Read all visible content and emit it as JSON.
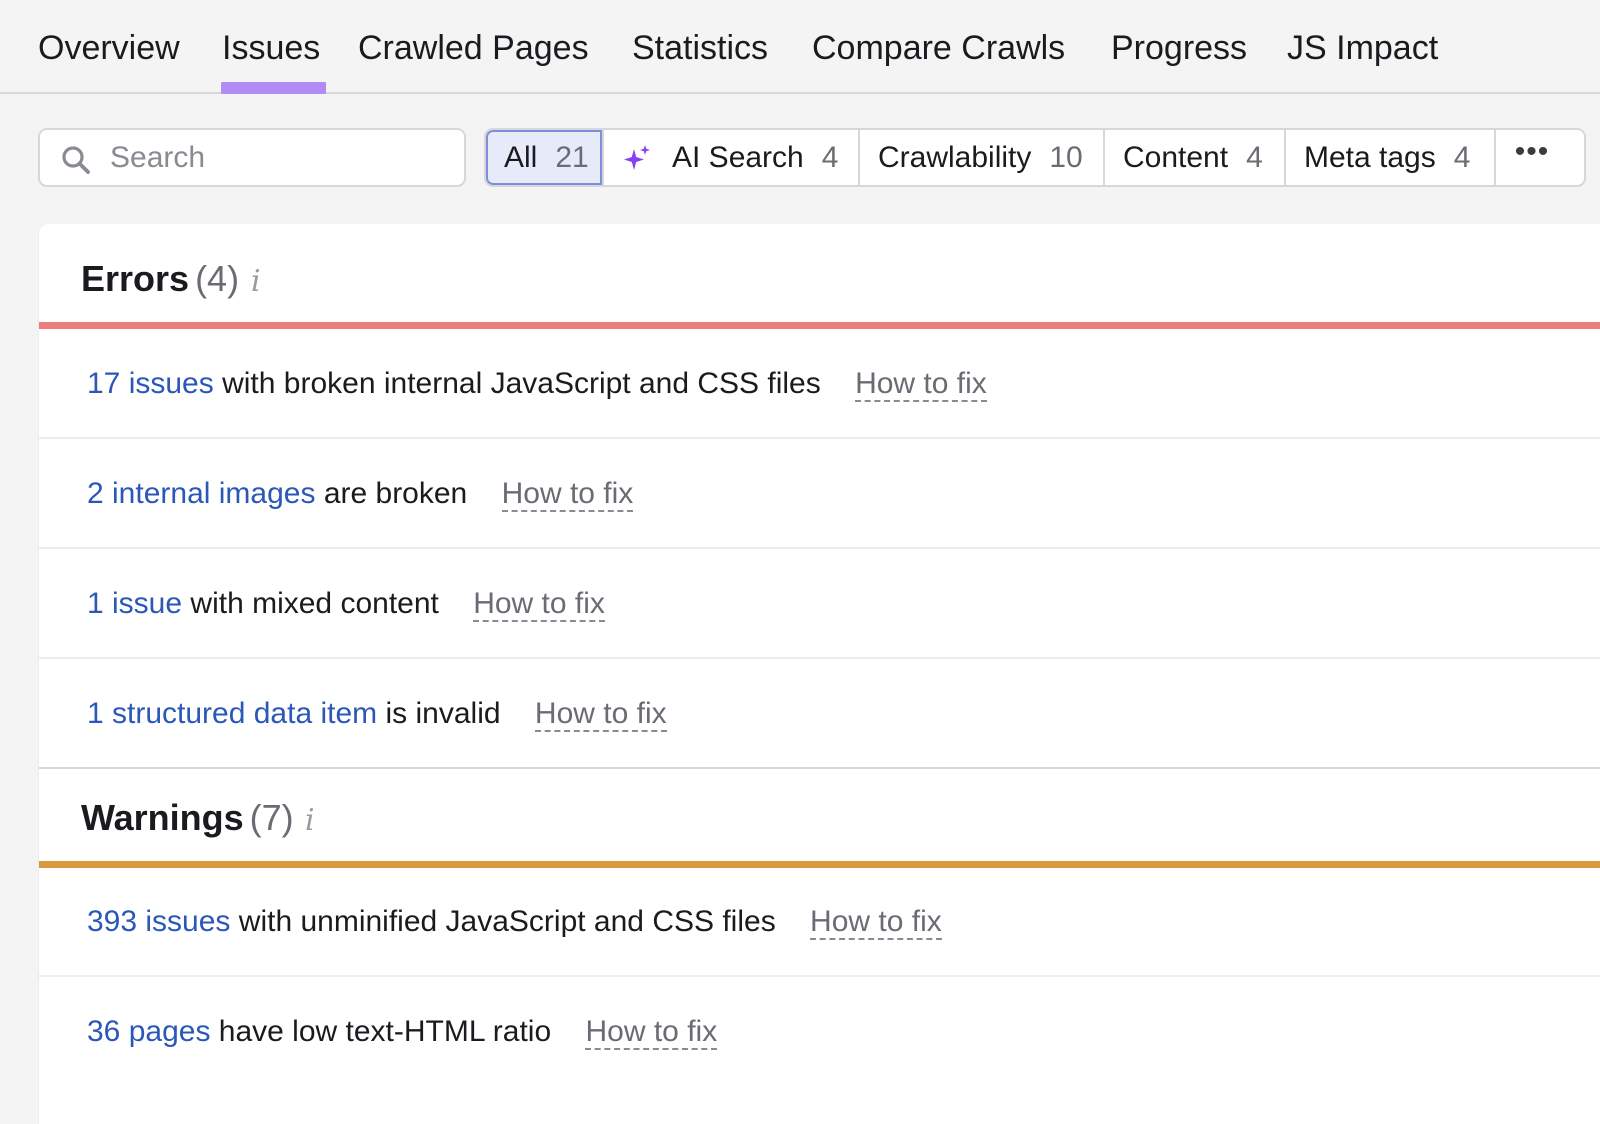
{
  "tabs": [
    {
      "label": "Overview"
    },
    {
      "label": "Issues",
      "active": true
    },
    {
      "label": "Crawled Pages"
    },
    {
      "label": "Statistics"
    },
    {
      "label": "Compare Crawls"
    },
    {
      "label": "Progress"
    },
    {
      "label": "JS Impact"
    }
  ],
  "colors": {
    "active_tab_underline": "#b18cf6",
    "errors_bar": "#ee7e7e",
    "warnings_bar": "#d99a3e",
    "link": "#2a57b8",
    "ai_sparkle": "#8a3ff0"
  },
  "search": {
    "placeholder": "Search",
    "value": "",
    "icon": "search-icon"
  },
  "filters": [
    {
      "label": "All",
      "count": "21",
      "active": true
    },
    {
      "label": "AI Search",
      "count": "4",
      "icon": "ai-sparkle-icon"
    },
    {
      "label": "Crawlability",
      "count": "10"
    },
    {
      "label": "Content",
      "count": "4"
    },
    {
      "label": "Meta tags",
      "count": "4"
    },
    {
      "label": "•••",
      "icon": "more-icon"
    }
  ],
  "errors": {
    "title": "Errors",
    "count": "(4)",
    "info": "i",
    "items": [
      {
        "link": "17 issues",
        "text": "with broken internal JavaScript and CSS files",
        "fix": "How to fix"
      },
      {
        "link": "2 internal images",
        "text": "are broken",
        "fix": "How to fix"
      },
      {
        "link": "1 issue",
        "text": "with mixed content",
        "fix": "How to fix"
      },
      {
        "link": "1 structured data item",
        "text": "is invalid",
        "fix": "How to fix"
      }
    ]
  },
  "warnings": {
    "title": "Warnings",
    "count": "(7)",
    "info": "i",
    "items": [
      {
        "link": "393 issues",
        "text": "with unminified JavaScript and CSS files",
        "fix": "How to fix"
      },
      {
        "link": "36 pages",
        "text": "have low text-HTML ratio",
        "fix": "How to fix"
      }
    ]
  }
}
